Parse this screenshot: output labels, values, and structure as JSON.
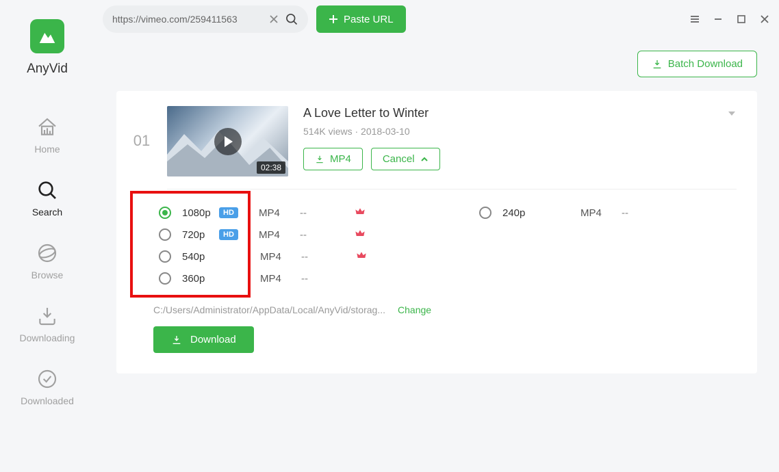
{
  "app": {
    "name": "AnyVid"
  },
  "sidebar": {
    "items": [
      {
        "label": "Home"
      },
      {
        "label": "Search"
      },
      {
        "label": "Browse"
      },
      {
        "label": "Downloading"
      },
      {
        "label": "Downloaded"
      }
    ]
  },
  "topbar": {
    "search_value": "https://vimeo.com/259411563",
    "paste_label": "Paste URL"
  },
  "batch": {
    "label": "Batch Download"
  },
  "video": {
    "index": "01",
    "duration": "02:38",
    "title": "A Love Letter to Winter",
    "meta": "514K views · 2018-03-10",
    "mp4_label": "MP4",
    "cancel_label": "Cancel"
  },
  "formats": {
    "left": [
      {
        "res": "1080p",
        "hd": "HD",
        "fmt": "MP4",
        "size": "--",
        "crown": true,
        "checked": true
      },
      {
        "res": "720p",
        "hd": "HD",
        "fmt": "MP4",
        "size": "--",
        "crown": true,
        "checked": false
      },
      {
        "res": "540p",
        "hd": "",
        "fmt": "MP4",
        "size": "--",
        "crown": true,
        "checked": false
      },
      {
        "res": "360p",
        "hd": "",
        "fmt": "MP4",
        "size": "--",
        "crown": false,
        "checked": false
      }
    ],
    "right": [
      {
        "res": "240p",
        "hd": "",
        "fmt": "MP4",
        "size": "--",
        "crown": false,
        "checked": false
      }
    ]
  },
  "path": {
    "value": "C:/Users/Administrator/AppData/Local/AnyVid/storag...",
    "change_label": "Change"
  },
  "download": {
    "label": "Download"
  }
}
